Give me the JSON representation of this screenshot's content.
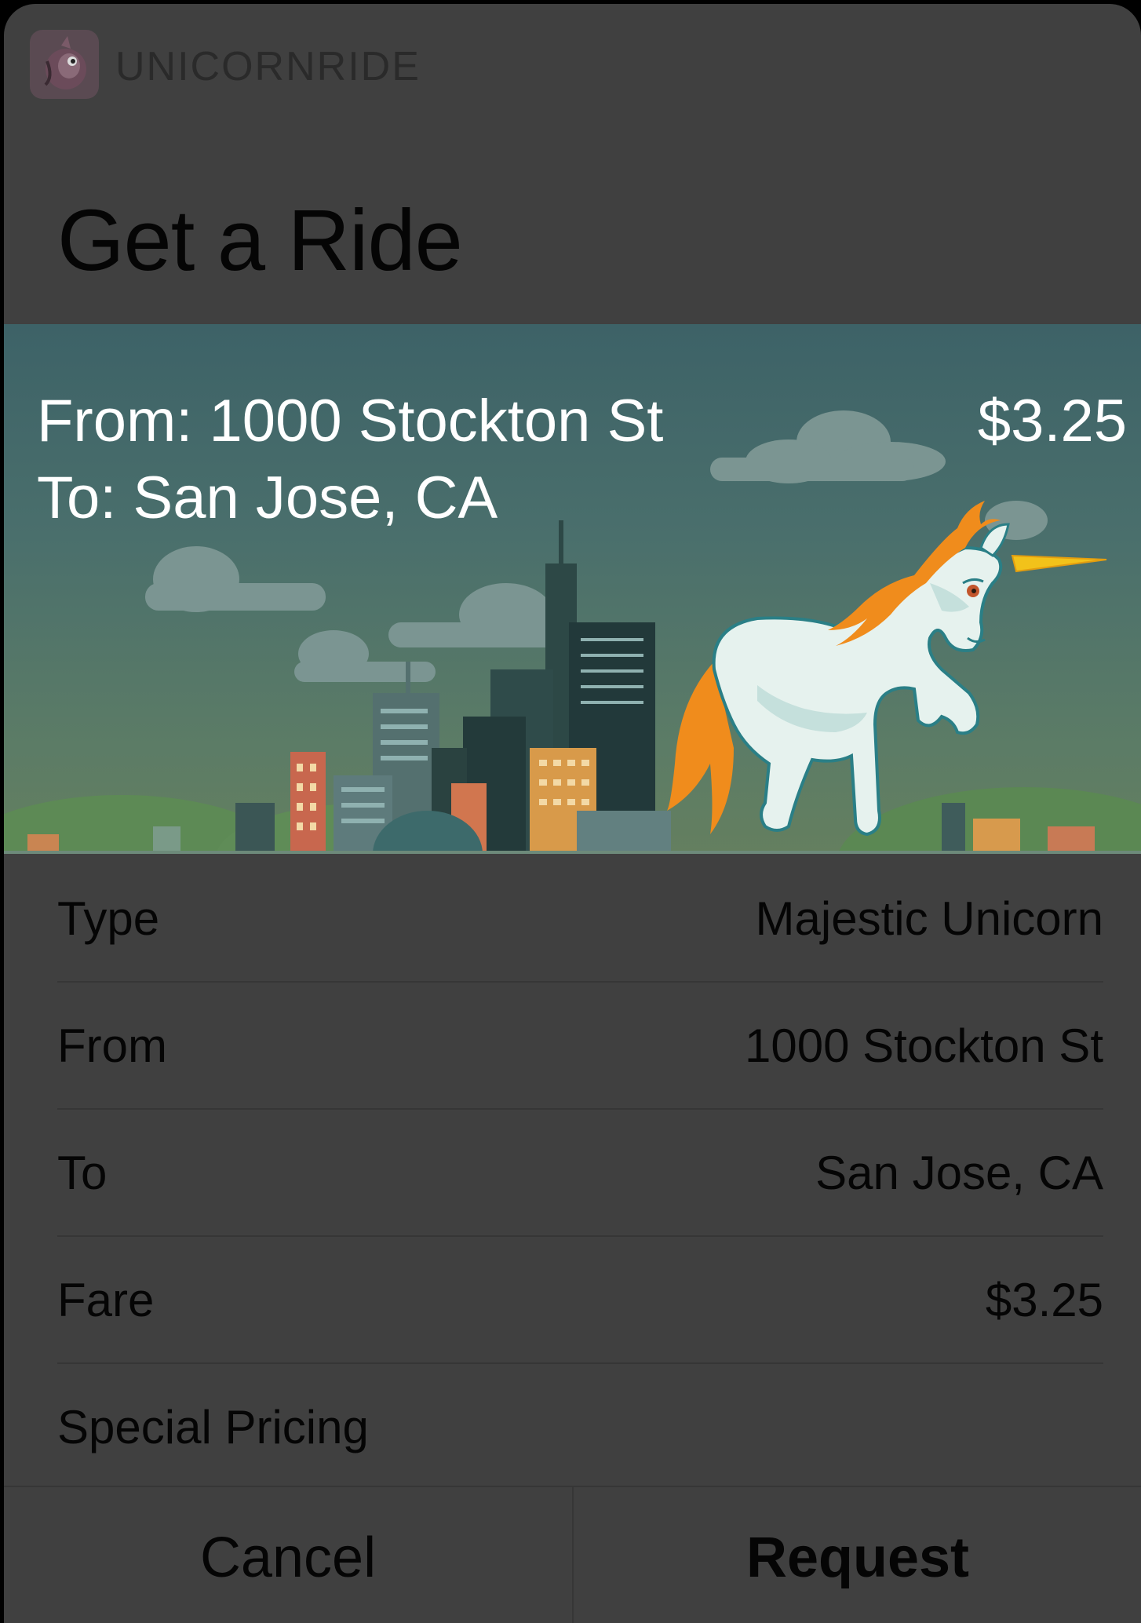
{
  "app": {
    "name": "UNICORNRIDE"
  },
  "page": {
    "title": "Get a Ride"
  },
  "hero": {
    "from_text": "From: 1000 Stockton St",
    "to_text": "To: San Jose, CA",
    "price": "$3.25"
  },
  "details": [
    {
      "label": "Type",
      "value": "Majestic Unicorn"
    },
    {
      "label": "From",
      "value": "1000 Stockton St"
    },
    {
      "label": "To",
      "value": "San Jose, CA"
    },
    {
      "label": "Fare",
      "value": "$3.25"
    },
    {
      "label": "Special Pricing",
      "value": ""
    }
  ],
  "actions": {
    "cancel": "Cancel",
    "request": "Request"
  },
  "colors": {
    "overlay": "#404040",
    "text": "#050505",
    "hero_sky": "#3d6267",
    "mane": "#f08c1c"
  }
}
